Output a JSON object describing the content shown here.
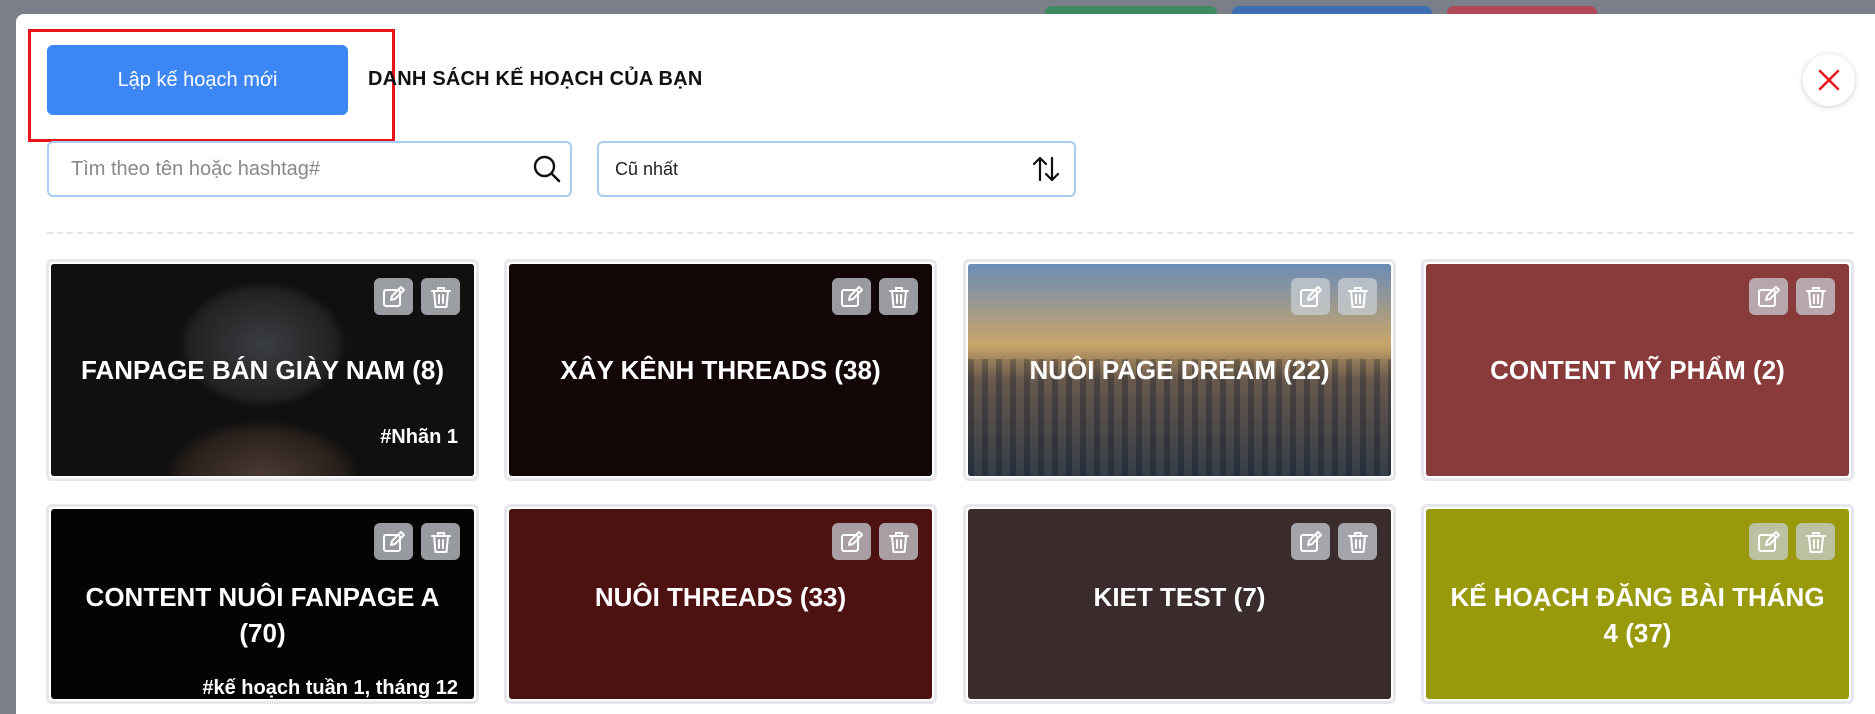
{
  "header": {
    "new_plan_label": "Lập kế hoạch mới",
    "list_title": "DANH SÁCH KẾ HOẠCH CỦA BẠN"
  },
  "search": {
    "placeholder": "Tìm theo tên hoặc hashtag#"
  },
  "sort": {
    "value": "Cũ nhất"
  },
  "colors": {
    "accent": "#3d86f5",
    "highlight": "#e8141b",
    "close": "#e8141b"
  },
  "plans": [
    {
      "title": "FANPAGE BÁN GIÀY NAM (8)",
      "hashtag": "#Nhãn 1",
      "background": "#101010",
      "image": "person-with-cap-photo"
    },
    {
      "title": "XÂY KÊNH THREADS (38)",
      "hashtag": "",
      "background": "#120606",
      "image": ""
    },
    {
      "title": "NUÔI PAGE DREAM (22)",
      "hashtag": "",
      "background": "#4f6e93",
      "image": "city-skyline-photo"
    },
    {
      "title": "CONTENT MỸ PHẨM (2)",
      "hashtag": "",
      "background": "#893a3a",
      "image": ""
    },
    {
      "title": "CONTENT NUÔI FANPAGE A (70)",
      "hashtag": "#kế hoạch tuần 1, tháng 12",
      "background": "#040404",
      "image": ""
    },
    {
      "title": "NUÔI THREADS (33)",
      "hashtag": "",
      "background": "#4d1111",
      "image": ""
    },
    {
      "title": "KIET TEST (7)",
      "hashtag": "",
      "background": "#3a2c2c",
      "image": ""
    },
    {
      "title": "KẾ HOẠCH ĐĂNG BÀI THÁNG 4 (37)",
      "hashtag": "",
      "background": "#989a0c",
      "image": ""
    }
  ],
  "icons": {
    "edit": "edit-icon",
    "delete": "trash-icon",
    "search": "search-icon",
    "sort": "sort-arrows-icon",
    "close": "close-icon"
  }
}
